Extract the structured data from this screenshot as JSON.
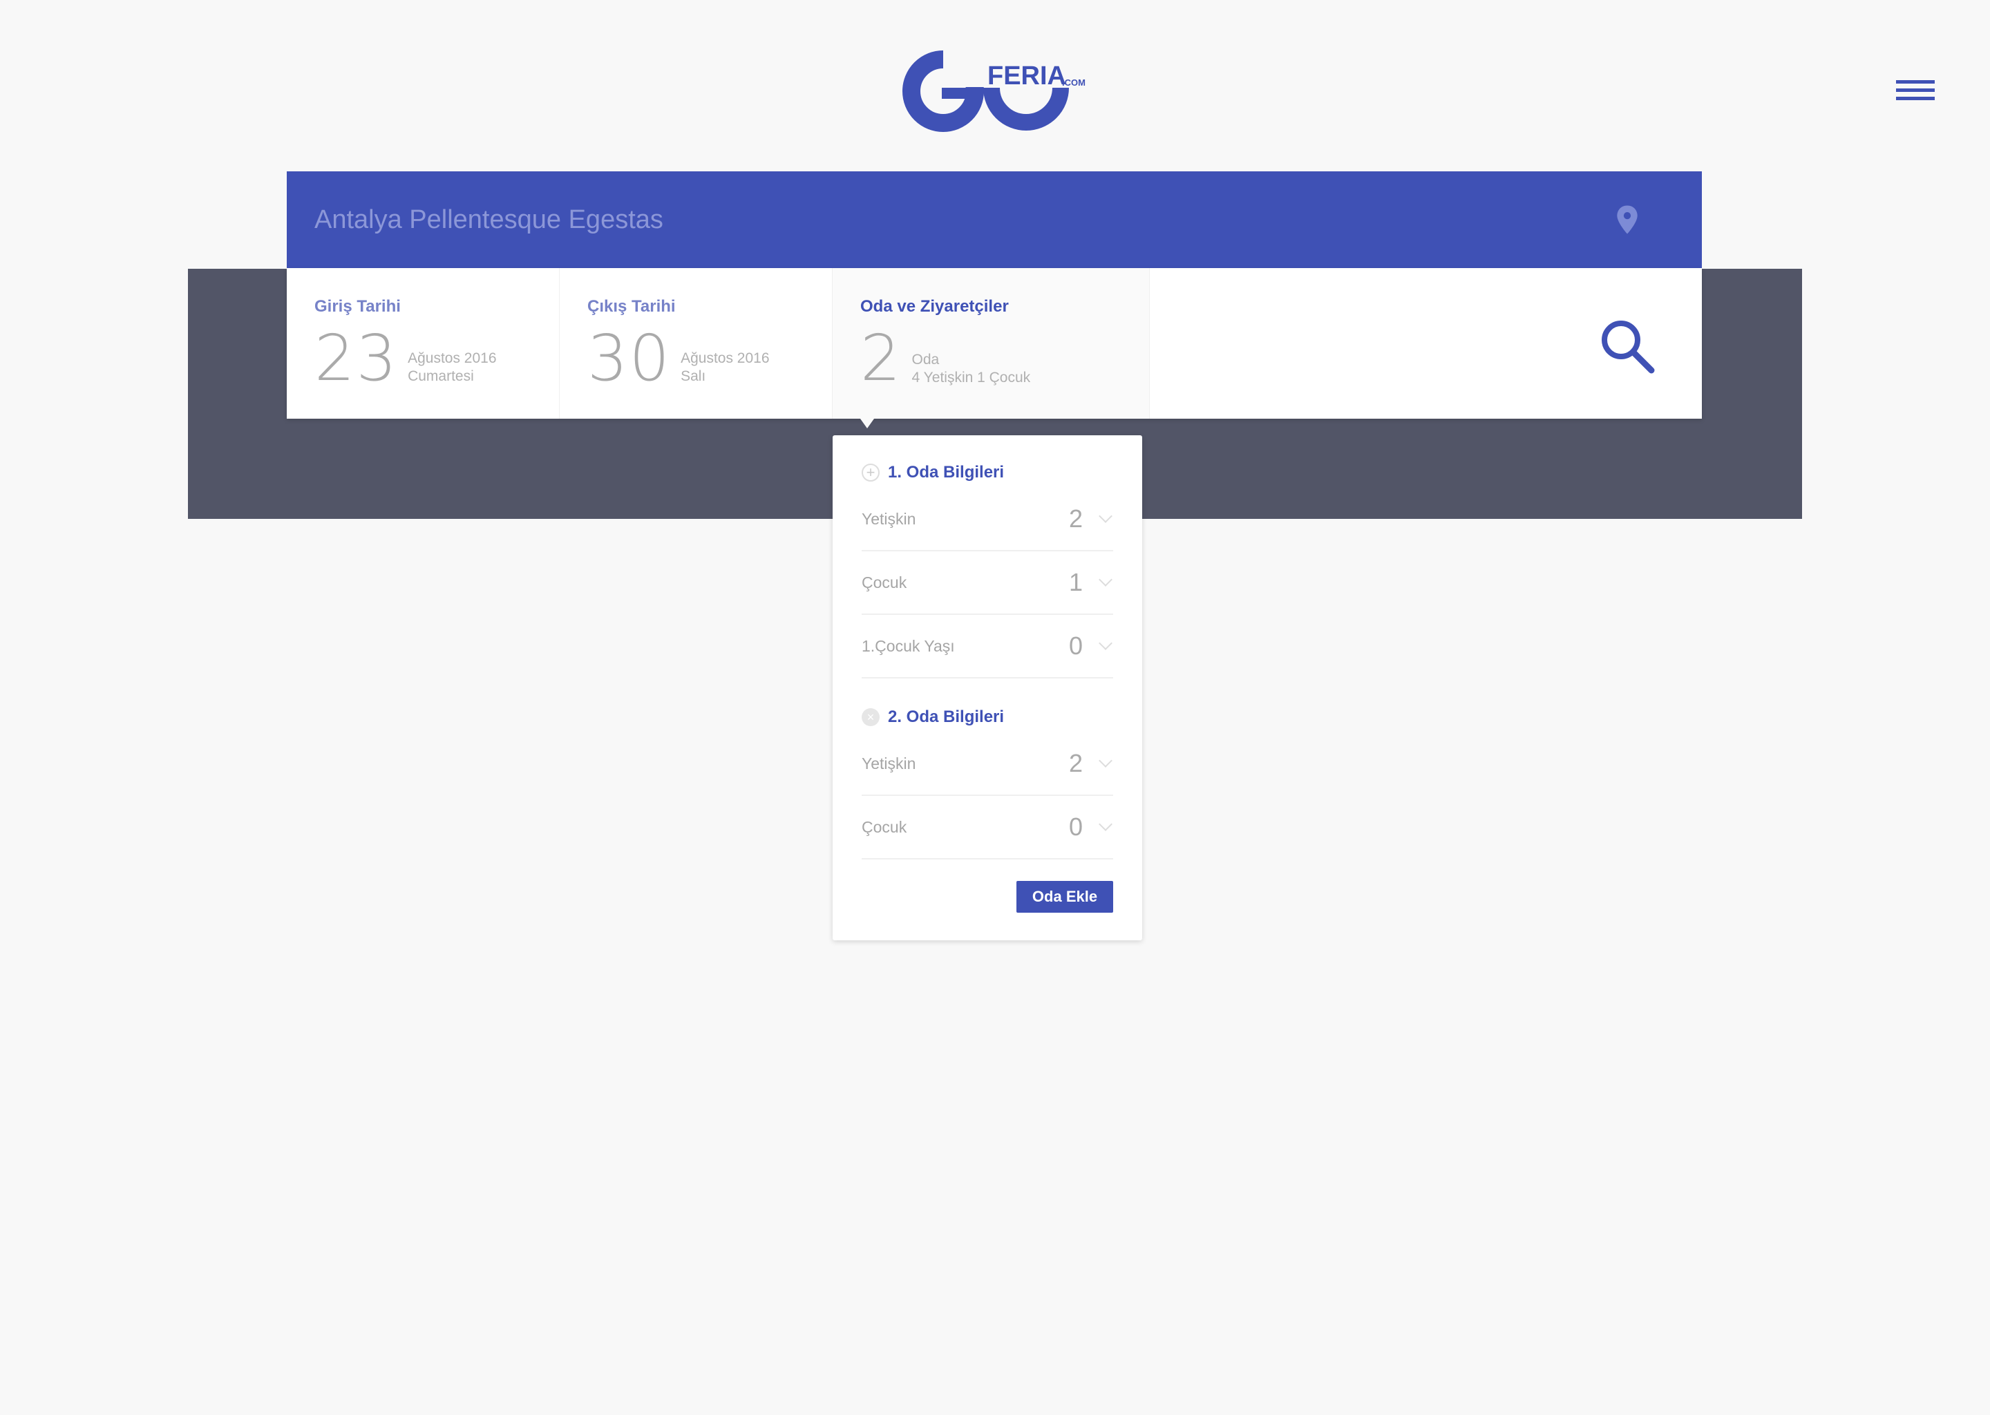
{
  "logo": {
    "text": "GO FERIA .com",
    "color": "#3f51b5"
  },
  "header": {
    "menu_icon": "hamburger-icon"
  },
  "search": {
    "destination": "Antalya Pellentesque Egestas",
    "checkin": {
      "label": "Giriş Tarihi",
      "day": "23",
      "month": "Ağustos 2016",
      "weekday": "Cumartesi"
    },
    "checkout": {
      "label": "Çıkış Tarihi",
      "day": "30",
      "month": "Ağustos 2016",
      "weekday": "Salı"
    },
    "rooms": {
      "label": "Oda ve Ziyaretçiler",
      "count": "2",
      "unit": "Oda",
      "summary": "4 Yetişkin 1 Çocuk"
    }
  },
  "panel": {
    "room1": {
      "title": "1. Oda Bilgileri",
      "fields": [
        {
          "label": "Yetişkin",
          "value": "2"
        },
        {
          "label": "Çocuk",
          "value": "1"
        },
        {
          "label": "1.Çocuk Yaşı",
          "value": "0"
        }
      ]
    },
    "room2": {
      "title": "2. Oda Bilgileri",
      "fields": [
        {
          "label": "Yetişkin",
          "value": "2"
        },
        {
          "label": "Çocuk",
          "value": "0"
        }
      ]
    },
    "add_label": "Oda Ekle"
  },
  "colors": {
    "primary": "#3f51b5",
    "band": "#525567",
    "background": "#f8f8f8"
  }
}
